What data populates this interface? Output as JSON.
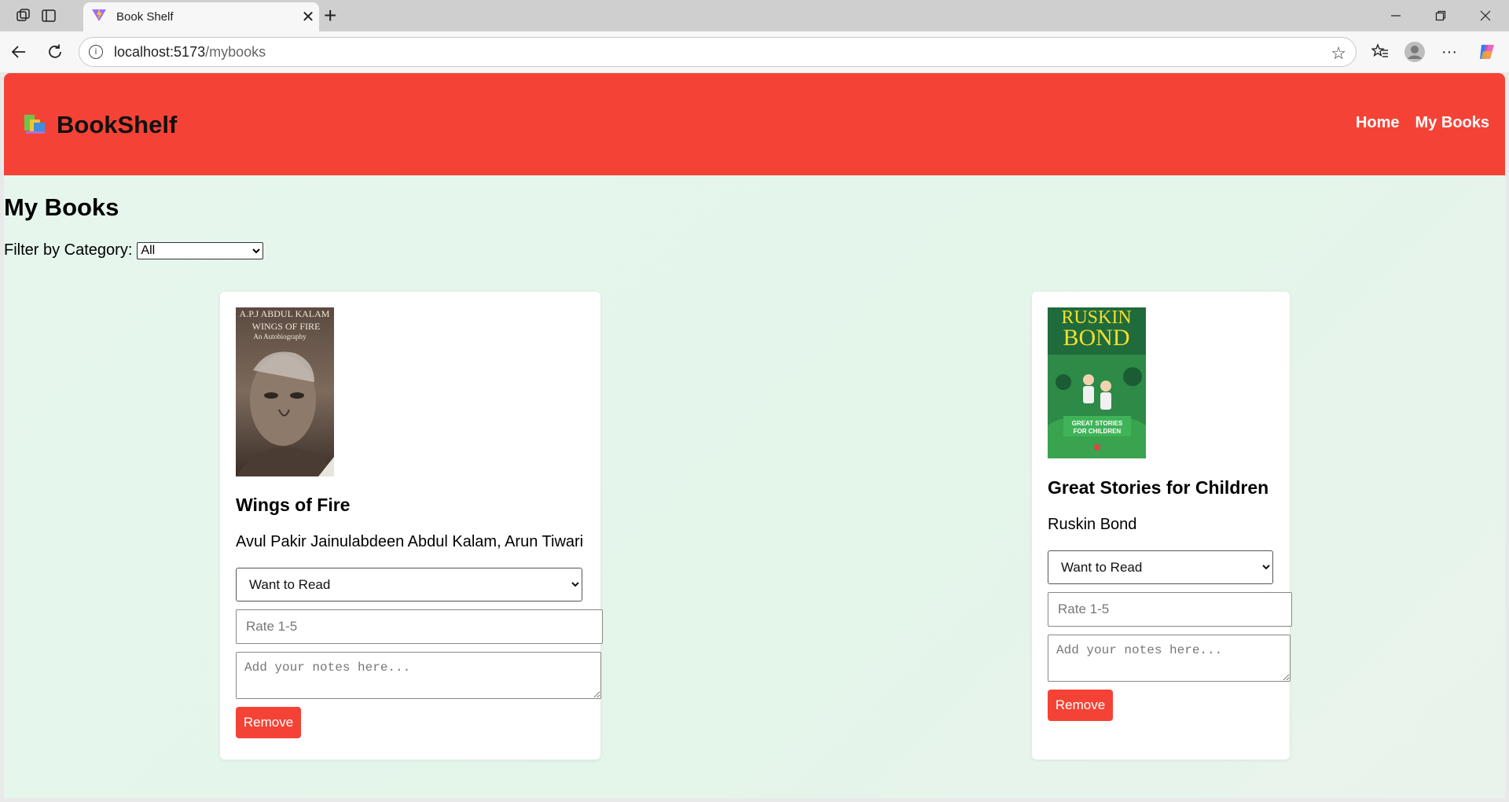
{
  "browser": {
    "tab_title": "Book Shelf",
    "url_host": "localhost:5173",
    "url_path": "/mybooks"
  },
  "navbar": {
    "brand": "BookShelf",
    "links": [
      "Home",
      "My Books"
    ]
  },
  "main": {
    "title": "My Books",
    "filter_label": "Filter by Category:",
    "filter_selected": "All"
  },
  "books": [
    {
      "title": "Wings of Fire",
      "author": "Avul Pakir Jainulabdeen Abdul Kalam, Arun Tiwari",
      "status": "Want to Read",
      "rating_placeholder": "Rate 1-5",
      "notes_placeholder": "Add your notes here...",
      "remove_label": "Remove",
      "cover": {
        "author_line": "A.P.J ABDUL KALAM",
        "title_line": "WINGS OF FIRE",
        "subtitle_line": "An Autobiography"
      }
    },
    {
      "title": "Great Stories for Children",
      "author": "Ruskin Bond",
      "status": "Want to Read",
      "rating_placeholder": "Rate 1-5",
      "notes_placeholder": "Add your notes here...",
      "remove_label": "Remove",
      "cover": {
        "author_line_1": "RUSKIN",
        "author_line_2": "BOND",
        "title_line_1": "GREAT STORIES",
        "title_line_2": "FOR CHILDREN"
      }
    }
  ],
  "colors": {
    "navbar": "#f44336",
    "remove_button": "#f44336",
    "page_background": "#e6f6ed"
  }
}
